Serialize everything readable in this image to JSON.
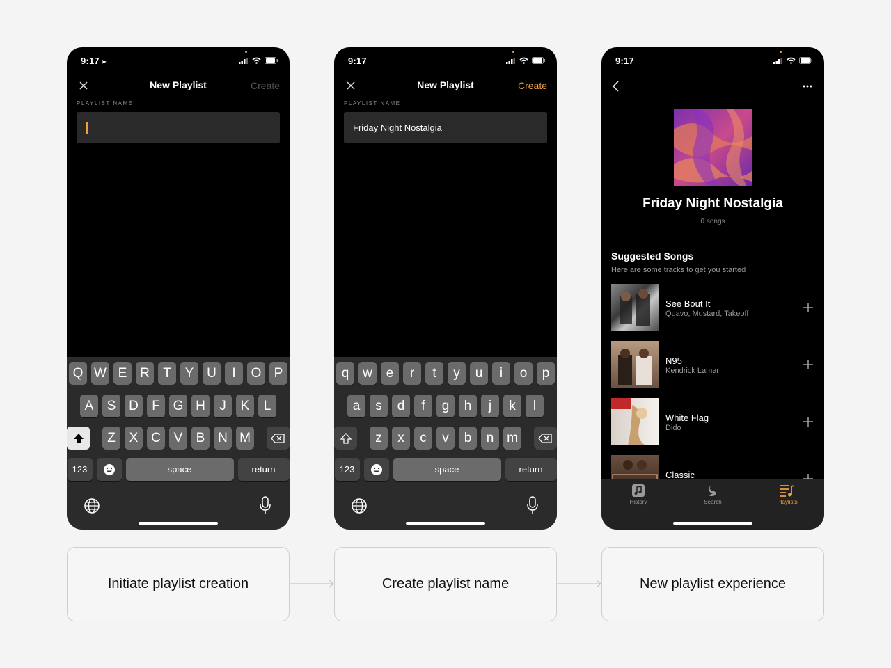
{
  "screens": [
    {
      "status_time": "9:17",
      "nav_title": "New Playlist",
      "create_label": "Create",
      "field_label": "PLAYLIST NAME",
      "field_value": "",
      "keyboard": {
        "row1": [
          "Q",
          "W",
          "E",
          "R",
          "T",
          "Y",
          "U",
          "I",
          "O",
          "P"
        ],
        "row2": [
          "A",
          "S",
          "D",
          "F",
          "G",
          "H",
          "J",
          "K",
          "L"
        ],
        "row3": [
          "Z",
          "X",
          "C",
          "V",
          "B",
          "N",
          "M"
        ],
        "numbers_label": "123",
        "space_label": "space",
        "return_label": "return"
      }
    },
    {
      "status_time": "9:17",
      "nav_title": "New Playlist",
      "create_label": "Create",
      "field_label": "PLAYLIST NAME",
      "field_value": "Friday Night Nostalgia",
      "keyboard": {
        "row1": [
          "q",
          "w",
          "e",
          "r",
          "t",
          "y",
          "u",
          "i",
          "o",
          "p"
        ],
        "row2": [
          "a",
          "s",
          "d",
          "f",
          "g",
          "h",
          "j",
          "k",
          "l"
        ],
        "row3": [
          "z",
          "x",
          "c",
          "v",
          "b",
          "n",
          "m"
        ],
        "numbers_label": "123",
        "space_label": "space",
        "return_label": "return"
      }
    },
    {
      "status_time": "9:17",
      "playlist_title": "Friday Night Nostalgia",
      "song_count": "0 songs",
      "suggested_title": "Suggested Songs",
      "suggested_subtitle": "Here are some tracks to get you started",
      "songs": [
        {
          "title": "See Bout It",
          "artist": "Quavo, Mustard, Takeoff"
        },
        {
          "title": "N95",
          "artist": "Kendrick Lamar"
        },
        {
          "title": "White Flag",
          "artist": "Dido"
        },
        {
          "title": "Classic",
          "artist": ""
        }
      ],
      "tabs": [
        {
          "label": "History",
          "icon": "music-note-icon"
        },
        {
          "label": "Search",
          "icon": "search-logo-icon"
        },
        {
          "label": "Playlists",
          "icon": "playlist-icon"
        }
      ]
    }
  ],
  "captions": [
    "Initiate playlist creation",
    "Create playlist name",
    "New playlist experience"
  ],
  "colors": {
    "accent": "#f0a040",
    "screen_bg": "#000000",
    "keyboard_bg": "#2b2b2b",
    "page_bg": "#f4f4f4"
  }
}
